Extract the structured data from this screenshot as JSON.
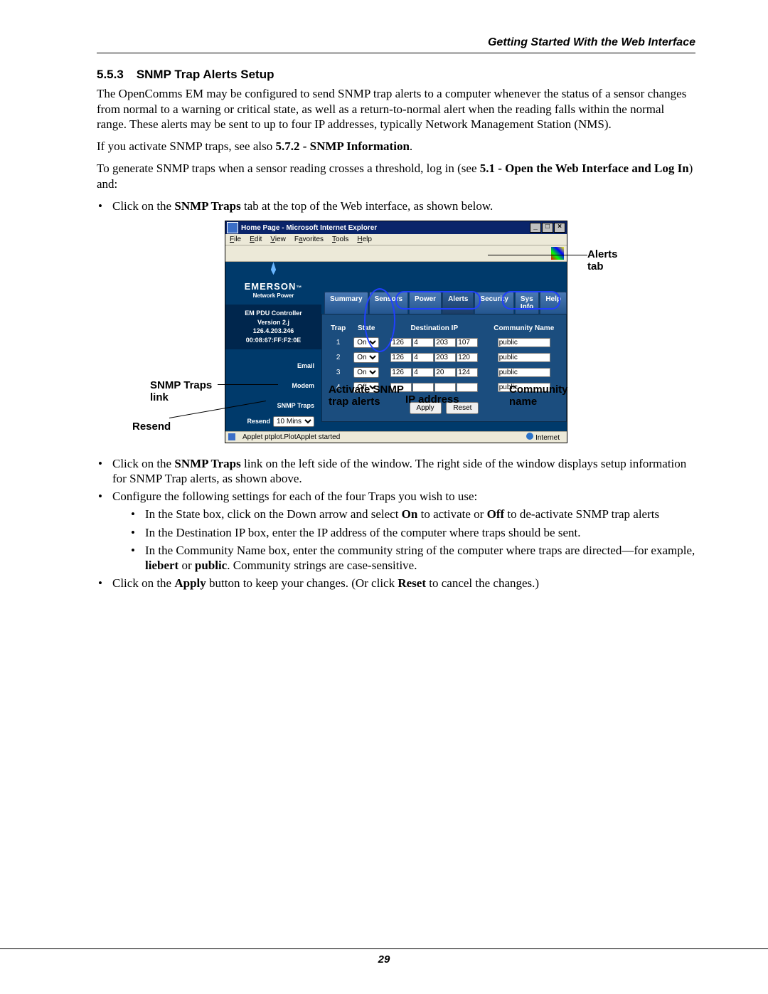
{
  "running_head": "Getting Started With the Web Interface",
  "section": {
    "number": "5.5.3",
    "title": "SNMP Trap Alerts Setup"
  },
  "p1": "The OpenComms EM may be configured to send SNMP trap alerts to a computer whenever the status of a sensor changes from normal to a warning or critical state, as well as a return-to-normal alert when the reading falls within the normal range. These alerts may be sent to up to four IP addresses, typically Network Management Station (NMS).",
  "p2_a": "If you activate SNMP traps, see also ",
  "p2_b": "5.7.2 - SNMP Information",
  "p2_c": ".",
  "p3_a": "To generate SNMP traps when a sensor reading crosses a threshold, log in (see ",
  "p3_b": "5.1 - Open the Web Interface and Log In",
  "p3_c": ") and:",
  "l1_a": "Click on the ",
  "l1_b": "SNMP Traps",
  "l1_c": " tab at the top of the Web interface, as shown below.",
  "l2_a": "Click on the ",
  "l2_b": "SNMP Traps",
  "l2_c": " link on the left side of the window. The right side of the window displays setup information for SNMP Trap alerts, as shown above.",
  "l3": "Configure the following settings for each of the four Traps you wish to use:",
  "l3s1_a": "In the State box, click on the Down arrow and select ",
  "l3s1_b": "On",
  "l3s1_c": " to activate or ",
  "l3s1_d": "Off",
  "l3s1_e": " to de-activate SNMP trap alerts",
  "l3s2": "In the Destination IP box, enter the IP address of the computer where traps should be sent.",
  "l3s3_a": "In the Community Name box, enter the community string of the computer where traps are directed—for example, ",
  "l3s3_b": "liebert",
  "l3s3_c": " or ",
  "l3s3_d": "public",
  "l3s3_e": ". Community strings are case-sensitive.",
  "l4_a": "Click on the ",
  "l4_b": "Apply",
  "l4_c": " button to keep your changes. (Or click ",
  "l4_d": "Reset",
  "l4_e": " to cancel the changes.)",
  "callouts": {
    "alerts_tab": "Alerts tab",
    "snmp_link1": "SNMP Traps",
    "snmp_link2": "link",
    "resend": "Resend",
    "activate1": "Activate SNMP",
    "activate2": "trap alerts",
    "ip": "IP address",
    "comm1": "Community",
    "comm2": "name"
  },
  "window": {
    "title": "Home Page - Microsoft Internet Explorer",
    "menus": [
      "File",
      "Edit",
      "View",
      "Favorites",
      "Tools",
      "Help"
    ],
    "brand": "EMERSON",
    "brand_tm": "™",
    "brand_sub": "Network Power",
    "controller": "EM PDU Controller",
    "version": "Version 2.j",
    "ip": "126.4.203.246",
    "mac": "00:08:67:FF:F2:0E",
    "links": {
      "email": "Email",
      "modem": "Modem",
      "snmp": "SNMP Traps"
    },
    "resend_label": "Resend",
    "resend_value": "10 Mins",
    "resend_options": [
      "10 Mins"
    ],
    "tabs": [
      "Summary",
      "Sensors",
      "Power",
      "Alerts",
      "Security",
      "Sys Info",
      "Help"
    ],
    "headers": {
      "trap": "Trap",
      "state": "State",
      "dest": "Destination IP",
      "comm": "Community Name"
    },
    "state_options": [
      "On",
      "Off"
    ],
    "rows": [
      {
        "n": "1",
        "state": "On",
        "ip": [
          "126",
          "4",
          "203",
          "107"
        ],
        "comm": "public"
      },
      {
        "n": "2",
        "state": "On",
        "ip": [
          "126",
          "4",
          "203",
          "120"
        ],
        "comm": "public"
      },
      {
        "n": "3",
        "state": "On",
        "ip": [
          "126",
          "4",
          "20",
          "124"
        ],
        "comm": "public"
      },
      {
        "n": "4",
        "state": "Off",
        "ip": [
          "",
          "",
          "",
          ""
        ],
        "comm": "public"
      }
    ],
    "buttons": {
      "apply": "Apply",
      "reset": "Reset"
    },
    "status_left": "Applet ptplot.PlotApplet started",
    "status_right": "Internet"
  },
  "page_number": "29"
}
